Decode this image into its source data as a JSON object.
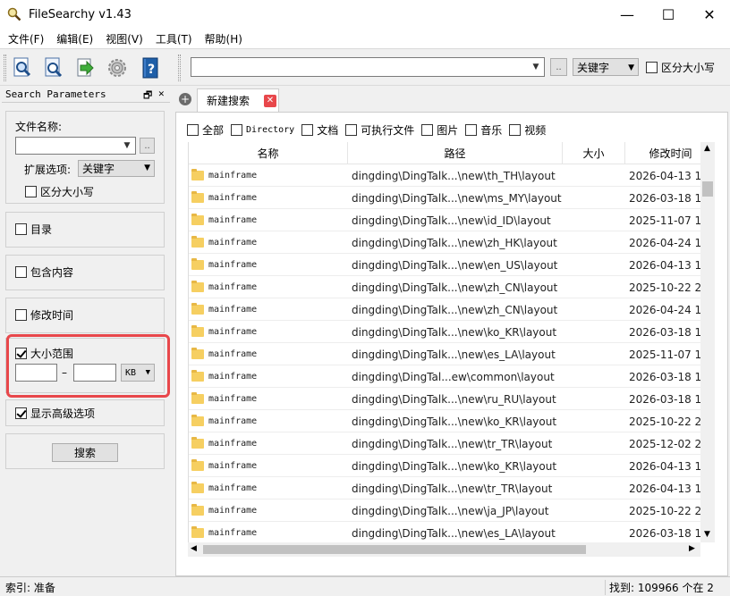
{
  "window": {
    "title": "FileSearchy v1.43",
    "minimize": "—",
    "maximize": "☐",
    "close": "✕"
  },
  "menu": [
    "文件(F)",
    "编辑(E)",
    "视图(V)",
    "工具(T)",
    "帮助(H)"
  ],
  "toolbar": {
    "search_value": "",
    "more": "..",
    "mode_select": "关键字",
    "case_label": "区分大小写"
  },
  "panel": {
    "title": "Search Parameters",
    "pin": "🗗",
    "close": "✕",
    "filename_label": "文件名称:",
    "filename_value": "",
    "more": "..",
    "ext_label": "扩展选项:",
    "ext_select": "关键字",
    "case_label": "区分大小写",
    "dir_label": "目录",
    "contains_label": "包含内容",
    "modified_label": "修改时间",
    "size_label": "大小范围",
    "size_dash": "–",
    "size_unit": "KB",
    "advanced_label": "显示高级选项",
    "search_button": "搜索"
  },
  "tabs": {
    "new_tab": "新建搜索",
    "close": "✕",
    "add": "+"
  },
  "filters": [
    "全部",
    "Directory",
    "文档",
    "可执行文件",
    "图片",
    "音乐",
    "视频"
  ],
  "columns": [
    "名称",
    "路径",
    "大小",
    "修改时间"
  ],
  "rows": [
    {
      "name": "mainframe",
      "path": "dingding\\DingTalk...\\new\\th_TH\\layout",
      "size": "",
      "modified": "2026-04-13 16"
    },
    {
      "name": "mainframe",
      "path": "dingding\\DingTalk...\\new\\ms_MY\\layout",
      "size": "",
      "modified": "2026-03-18 14"
    },
    {
      "name": "mainframe",
      "path": "dingding\\DingTalk...\\new\\id_ID\\layout",
      "size": "",
      "modified": "2025-11-07 17"
    },
    {
      "name": "mainframe",
      "path": "dingding\\DingTalk...\\new\\zh_HK\\layout",
      "size": "",
      "modified": "2026-04-24 16"
    },
    {
      "name": "mainframe",
      "path": "dingding\\DingTalk...\\new\\en_US\\layout",
      "size": "",
      "modified": "2026-04-13 16"
    },
    {
      "name": "mainframe",
      "path": "dingding\\DingTalk...\\new\\zh_CN\\layout",
      "size": "",
      "modified": "2025-10-22 20"
    },
    {
      "name": "mainframe",
      "path": "dingding\\DingTalk...\\new\\zh_CN\\layout",
      "size": "",
      "modified": "2026-04-24 16"
    },
    {
      "name": "mainframe",
      "path": "dingding\\DingTalk...\\new\\ko_KR\\layout",
      "size": "",
      "modified": "2026-03-18 14"
    },
    {
      "name": "mainframe",
      "path": "dingding\\DingTalk...\\new\\es_LA\\layout",
      "size": "",
      "modified": "2025-11-07 17"
    },
    {
      "name": "mainframe",
      "path": "dingding\\DingTal...ew\\common\\layout",
      "size": "",
      "modified": "2026-03-18 14"
    },
    {
      "name": "mainframe",
      "path": "dingding\\DingTalk...\\new\\ru_RU\\layout",
      "size": "",
      "modified": "2026-03-18 14"
    },
    {
      "name": "mainframe",
      "path": "dingding\\DingTalk...\\new\\ko_KR\\layout",
      "size": "",
      "modified": "2025-10-22 20"
    },
    {
      "name": "mainframe",
      "path": "dingding\\DingTalk...\\new\\tr_TR\\layout",
      "size": "",
      "modified": "2025-12-02 20"
    },
    {
      "name": "mainframe",
      "path": "dingding\\DingTalk...\\new\\ko_KR\\layout",
      "size": "",
      "modified": "2026-04-13 16"
    },
    {
      "name": "mainframe",
      "path": "dingding\\DingTalk...\\new\\tr_TR\\layout",
      "size": "",
      "modified": "2026-04-13 16"
    },
    {
      "name": "mainframe",
      "path": "dingding\\DingTalk...\\new\\ja_JP\\layout",
      "size": "",
      "modified": "2025-10-22 20"
    },
    {
      "name": "mainframe",
      "path": "dingding\\DingTalk...\\new\\es_LA\\layout",
      "size": "",
      "modified": "2026-03-18 14"
    }
  ],
  "status": {
    "left": "索引: 准备",
    "right": "找到: 109966 个在 2"
  },
  "colors": {
    "highlight": "#e8474b",
    "folder": "#f6cf61",
    "help_icon": "#1f5fa8"
  }
}
